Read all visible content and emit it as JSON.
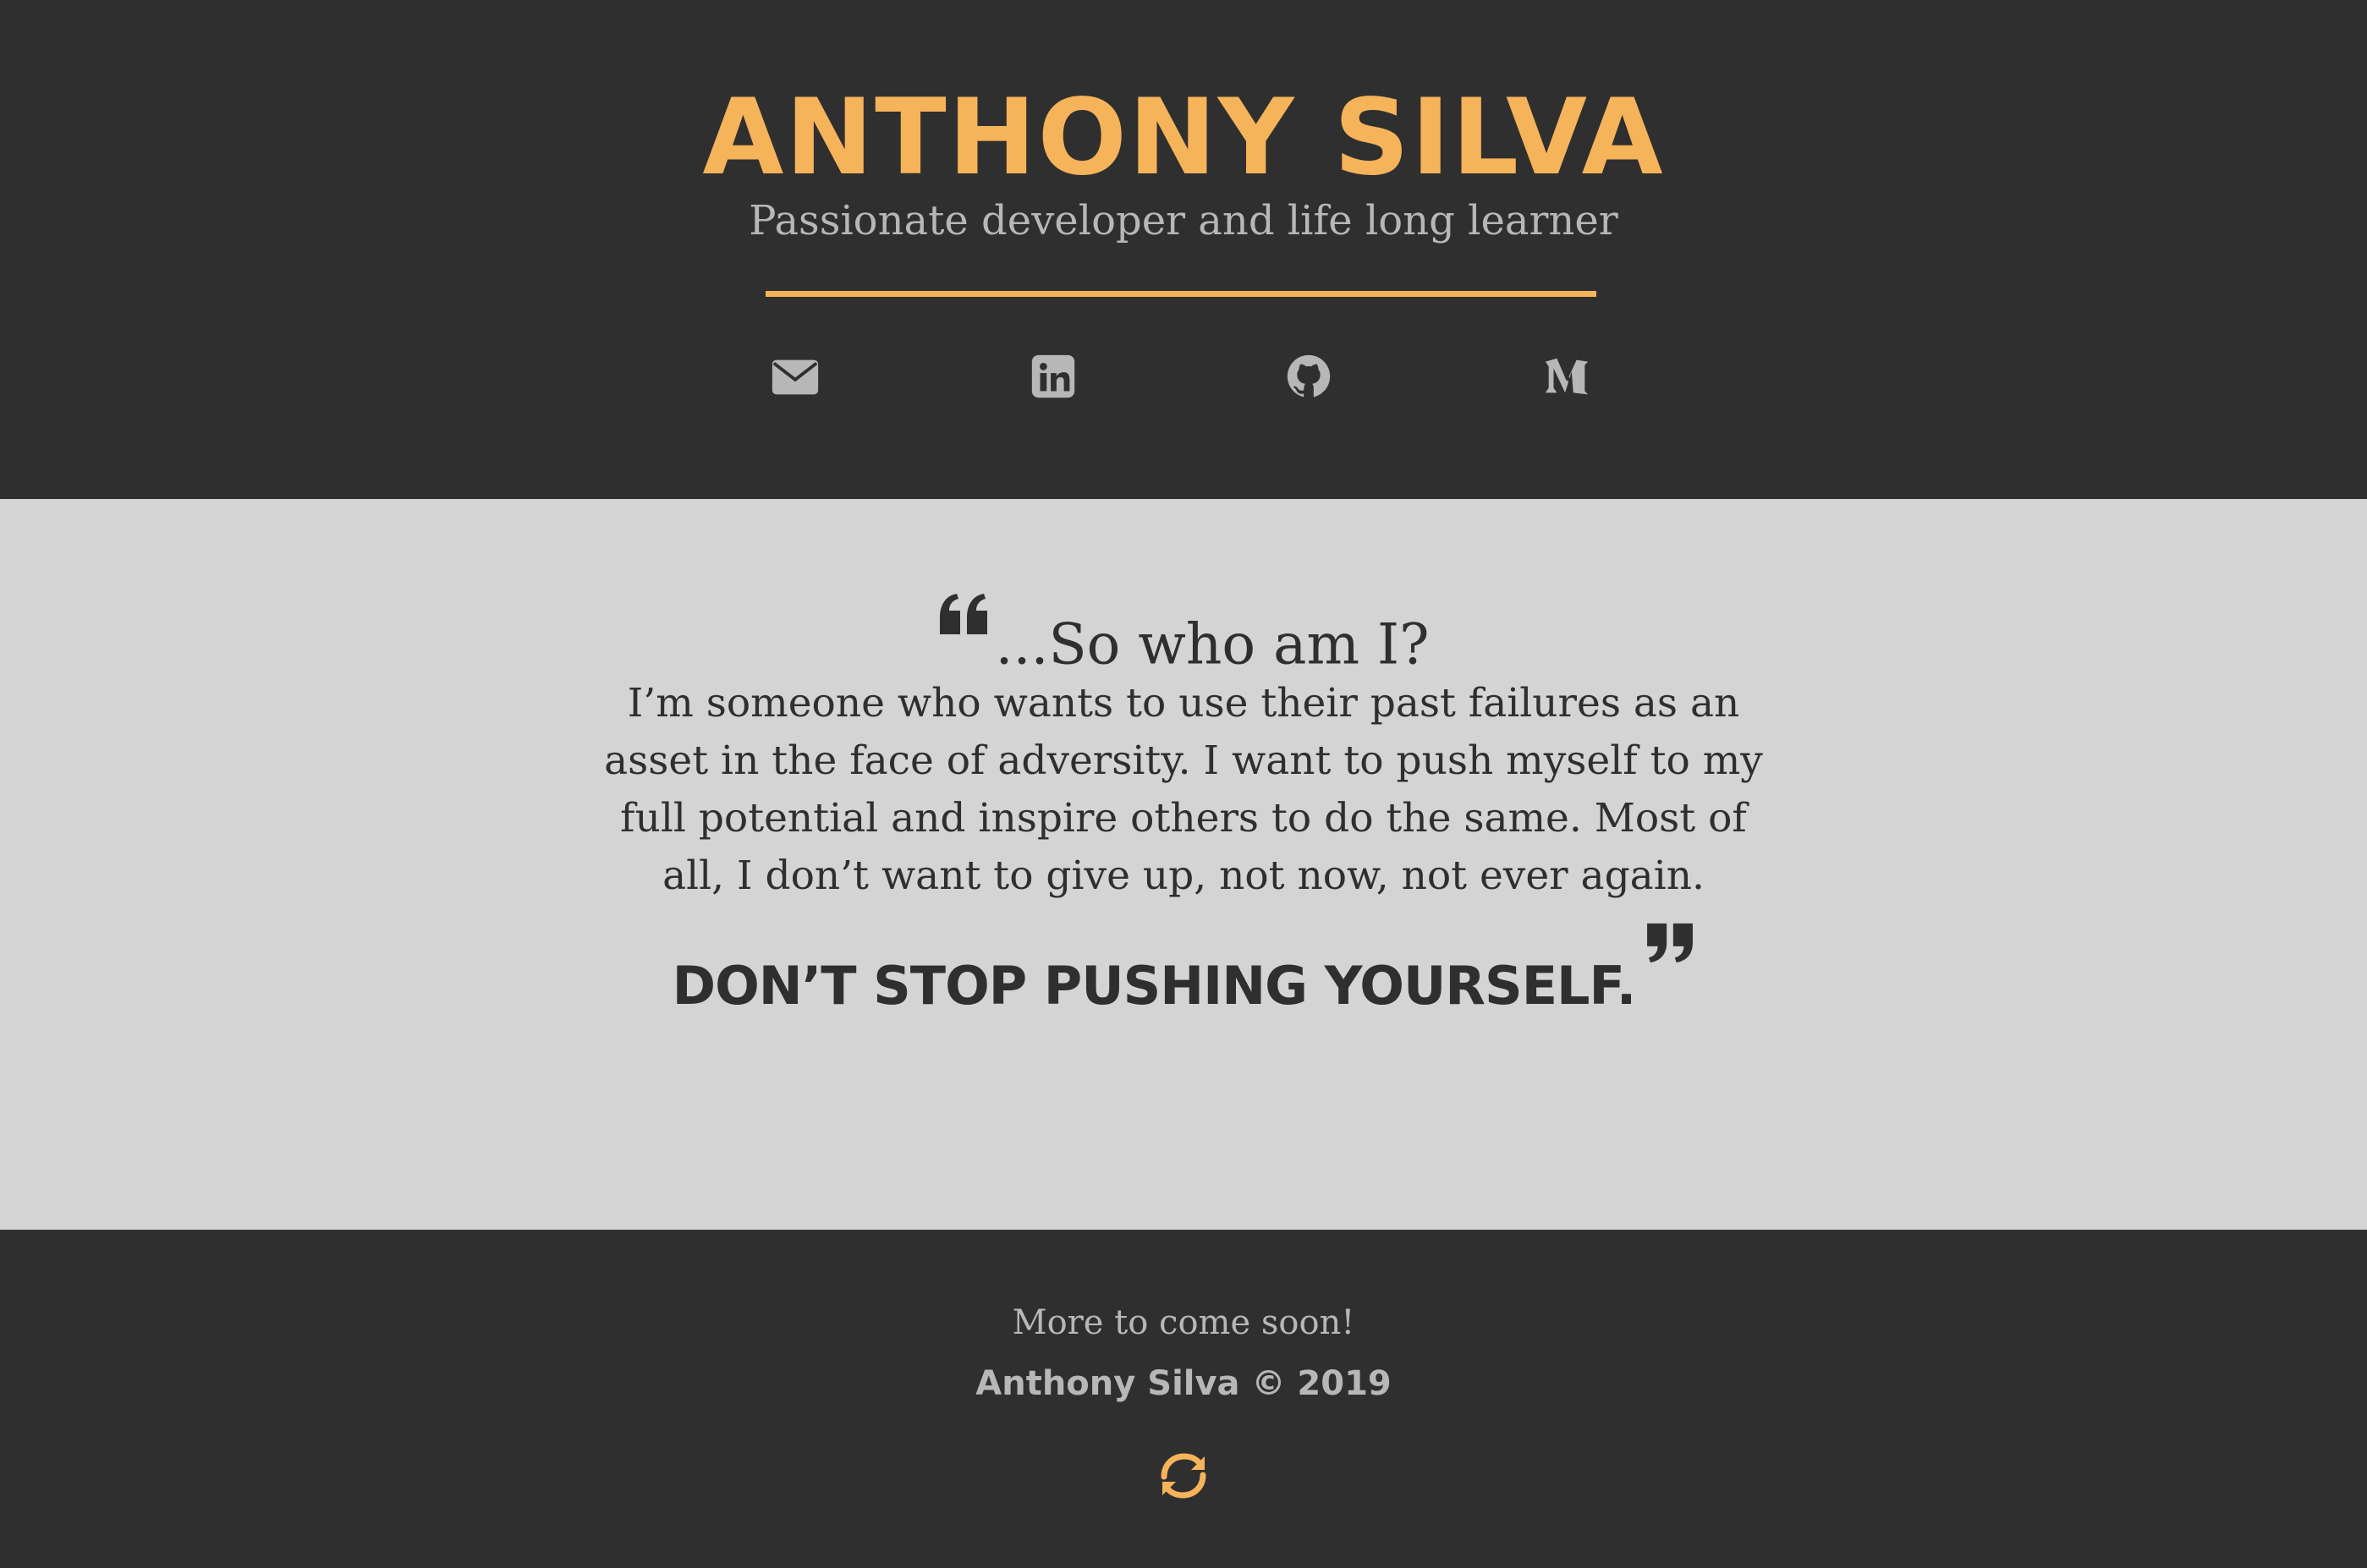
{
  "header": {
    "name": "ANTHONY SILVA",
    "tagline": "Passionate developer and life long learner",
    "social": [
      {
        "icon": "envelope-icon",
        "label": "Email"
      },
      {
        "icon": "linkedin-icon",
        "label": "LinkedIn"
      },
      {
        "icon": "github-icon",
        "label": "GitHub"
      },
      {
        "icon": "medium-icon",
        "label": "Medium"
      }
    ]
  },
  "about": {
    "title": "...So who am I?",
    "paragraph": "I’m someone who wants to use their past failures as an asset in the face of adversity. I want to push myself to my full potential and inspire others to do the same. Most of all, I don’t want to give up, not now, not ever again.",
    "motto": "DON’T STOP PUSHING YOURSELF."
  },
  "footer": {
    "note": "More to come soon!",
    "copyright": "Anthony Silva © 2019",
    "refresh_icon": "refresh-icon"
  },
  "colors": {
    "accent": "#f5b35a",
    "dark": "#2f2f2f",
    "light": "#d4d4d4",
    "muted": "#b7b7b7"
  }
}
